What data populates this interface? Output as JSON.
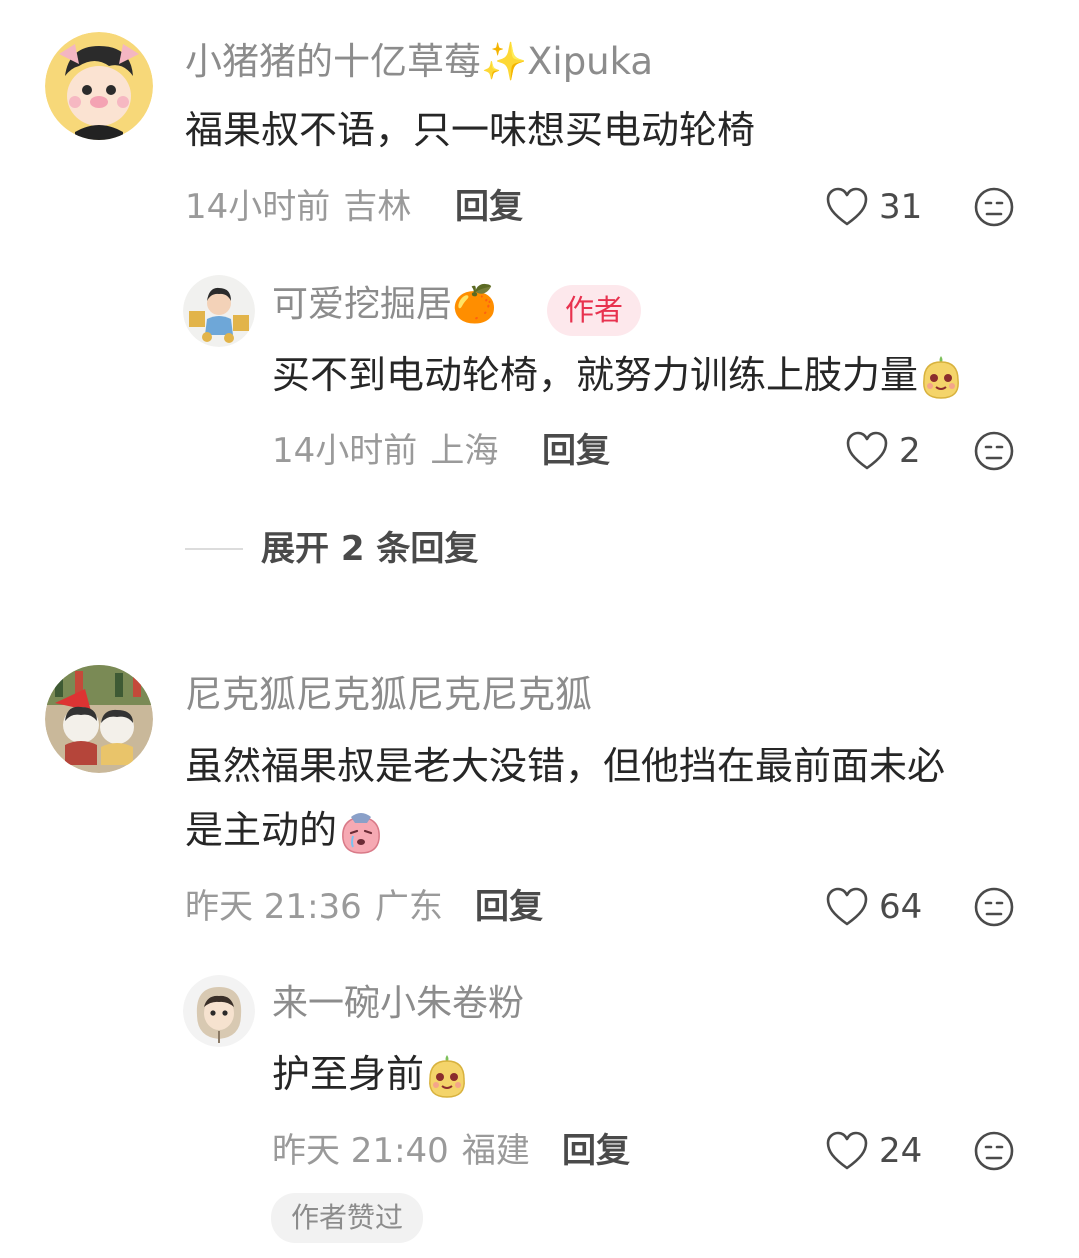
{
  "comments": [
    {
      "username": "小猪猪的十亿草莓✨Xipuka",
      "text": "福果叔不语，只一味想买电动轮椅",
      "time": "14小时前",
      "location": "吉林",
      "reply_label": "回复",
      "likes": "31",
      "replies": [
        {
          "username": "可爱挖掘居🍊",
          "author_tag": "作者",
          "text": "买不到电动轮椅，就努力训练上肢力量",
          "time": "14小时前",
          "location": "上海",
          "reply_label": "回复",
          "likes": "2"
        }
      ],
      "expand_label": "展开 2 条回复"
    },
    {
      "username": "尼克狐尼克狐尼克尼克狐",
      "text_line1": "虽然福果叔是老大没错，但他挡在最前面未必",
      "text_line2": "是主动的",
      "time": "昨天 21:36",
      "location": "广东",
      "reply_label": "回复",
      "likes": "64",
      "replies": [
        {
          "username": "来一碗小朱卷粉",
          "text": "护至身前",
          "time": "昨天 21:40",
          "location": "福建",
          "reply_label": "回复",
          "likes": "24",
          "liked_by_author": "作者赞过"
        }
      ]
    }
  ],
  "icons": {
    "like": "heart-outline-icon",
    "dislike": "unhappy-face-icon",
    "emoji": "fruit-mascot-emoji",
    "emoji_sad": "crying-pink-emoji"
  },
  "colors": {
    "author_tag_bg": "#fde8ec",
    "author_tag_text": "#e8324f",
    "name": "#8c8c8c",
    "text": "#262626"
  }
}
